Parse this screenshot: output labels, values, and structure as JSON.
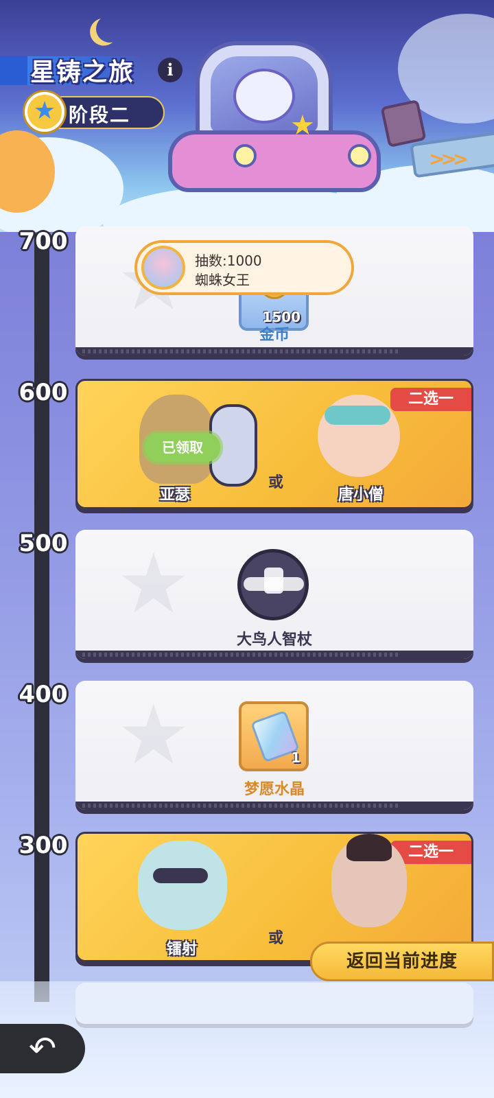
{
  "header": {
    "title": "星铸之旅",
    "info_icon": "i",
    "stage": "阶段二"
  },
  "timeline": {
    "ticks": [
      "700",
      "600",
      "500",
      "400",
      "300"
    ]
  },
  "popup": {
    "line1": "抽数:1000",
    "line2": "蜘蛛女王"
  },
  "cards": [
    {
      "tier": "700",
      "reward": {
        "name": "金币",
        "quantity": "1500"
      }
    },
    {
      "tier": "600",
      "badge": "二选一",
      "or_label": "或",
      "left": {
        "name": "亚瑟",
        "status": "已领取"
      },
      "right": {
        "name": "唐小僧"
      }
    },
    {
      "tier": "500",
      "reward": {
        "name": "大鸟人智杖"
      }
    },
    {
      "tier": "400",
      "reward": {
        "name": "梦愿水晶",
        "quantity": "1"
      }
    },
    {
      "tier": "300",
      "badge": "二选一",
      "or_label": "或",
      "left": {
        "name": "镭射"
      },
      "right": {
        "name": ""
      }
    }
  ],
  "return_button": "返回当前进度",
  "colors": {
    "gold_card": "#f7bd3a",
    "badge_red": "#e54b45",
    "coin_label": "#3a7fc9",
    "crystal_label": "#d98a2a"
  },
  "icons": {
    "back": "back-arrow-icon",
    "info": "info-icon",
    "stage": "star-icon"
  }
}
